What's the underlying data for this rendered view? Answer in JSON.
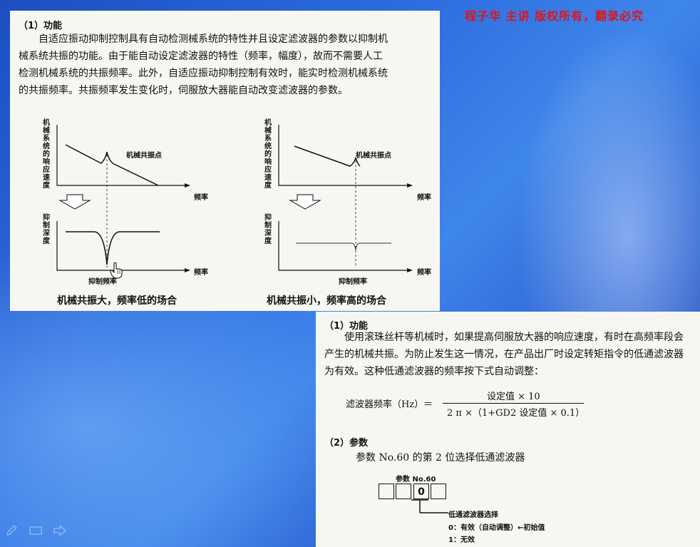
{
  "copyright": "程子华 主讲  版权所有，翻录必究",
  "panel1": {
    "title": "（1）功能",
    "paragraph_lines": [
      "自适应振动抑制控制具有自动检测械系统的特性并且设定滤波器的参数以抑制机",
      "械系统共振的功能。由于能自动设定滤波器的特性（频率，幅度），故而不需要人工",
      "检测机械系统的共振频率。此外，自适应振动抑制控制有效时，能实时检测机械系统",
      "的共振频率。共振频率发生变化时，伺服放大器能自动改变滤波器的参数。"
    ],
    "graph_left": {
      "y_label_top": "机械系统的响应速度",
      "peak_label": "机械共振点",
      "x_label_top": "频率",
      "y_label_bottom": "抑制深度",
      "x_label_bottom": "频率",
      "notch_label": "抑制频率",
      "caption": "机械共振大，频率低的场合"
    },
    "graph_right": {
      "y_label_top": "机械系统的响应速度",
      "peak_label": "机械共振点",
      "x_label_top": "频率",
      "y_label_bottom": "抑制深度",
      "x_label_bottom": "频率",
      "notch_label": "抑制频率",
      "caption": "机械共振小，频率高的场合"
    }
  },
  "panel2": {
    "title": "（1）功能",
    "paragraph_lines": [
      "使用滚珠丝杆等机械时，如果提高伺服放大器的响应速度，有时在高频率段会",
      "产生的机械共振。为防止发生这一情况，在产品出厂时设定转矩指令的低通滤波器",
      "为有效。这种低通滤波器的频率按下式自动调整："
    ],
    "formula": {
      "lhs": "滤波器频率（Hz）＝",
      "numerator": "设定值 × 10",
      "denominator": "2 π ×（1+GD2 设定值 × 0.1）"
    },
    "section2_title": "（2）参数",
    "param_desc": "参数 No.60 的第 2 位选择低通滤波器",
    "param_box_label": "参数 No.60",
    "digits": [
      "",
      "",
      "0",
      ""
    ],
    "lpf_label": "低通滤波器选择",
    "option_0": "0：有效（自动调整）←初始值",
    "option_1": "1：无效"
  },
  "toolbar": {
    "icons": [
      "pen-icon",
      "screen-icon",
      "arrow-right-icon"
    ]
  }
}
